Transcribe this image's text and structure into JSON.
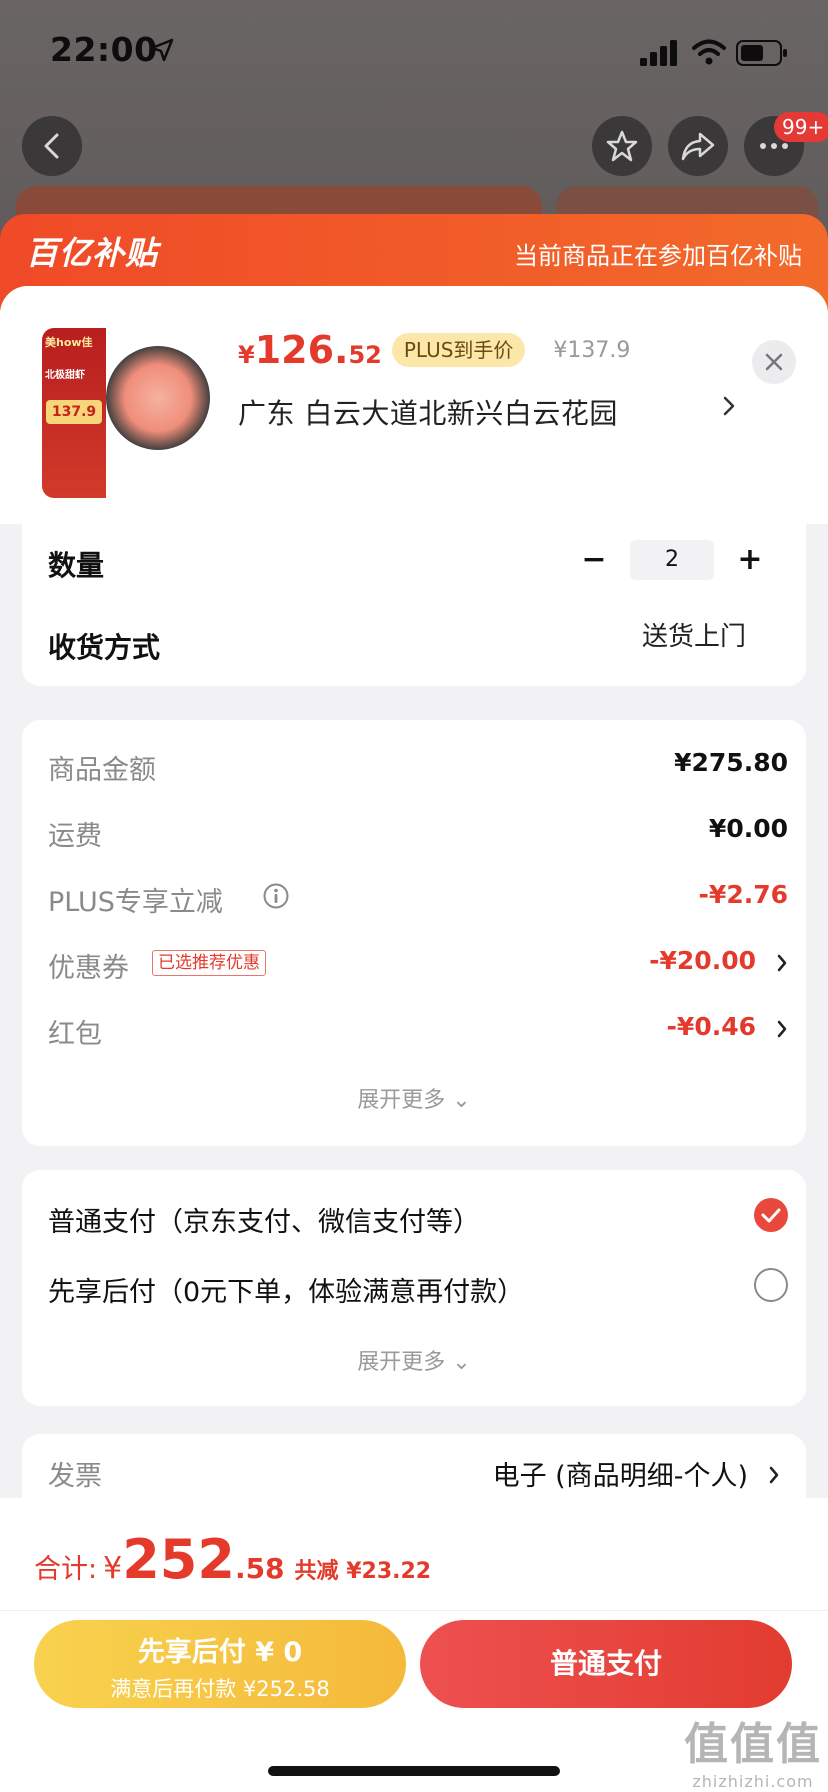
{
  "status_bar": {
    "time": "22:00"
  },
  "top_nav": {
    "badge": "99+"
  },
  "header": {
    "logo": "百亿补贴",
    "note": "当前商品正在参加百亿补贴"
  },
  "product": {
    "thumb_brand": "美how佳",
    "thumb_title": "北极甜虾",
    "thumb_price": "137.9",
    "price_symbol": "¥",
    "price_int": "126.",
    "price_dec": "52",
    "plus_tag": "PLUS到手价",
    "original_price": "¥137.9",
    "address": "广东  白云大道北新兴白云花园"
  },
  "order": {
    "qty_label": "数量",
    "qty_value": "2",
    "delivery_label": "收货方式",
    "delivery_value": "送货上门"
  },
  "costs": {
    "items": [
      {
        "label": "商品金额",
        "value": "¥275.80"
      },
      {
        "label": "运费",
        "value": "¥0.00"
      },
      {
        "label": "PLUS专享立减",
        "value": "-¥2.76"
      },
      {
        "label": "优惠券",
        "tag": "已选推荐优惠",
        "value": "-¥20.00"
      },
      {
        "label": "红包",
        "value": "-¥0.46"
      }
    ],
    "expand": "展开更多 ⌄"
  },
  "payment": {
    "options": [
      {
        "label": "普通支付（京东支付、微信支付等）",
        "selected": true
      },
      {
        "label": "先享后付（0元下单，体验满意再付款）",
        "selected": false
      }
    ],
    "expand": "展开更多 ⌄"
  },
  "invoice": {
    "label": "发票",
    "value": "电子 (商品明细-个人)"
  },
  "bottom": {
    "total_label": "合计:",
    "total_symbol": "¥",
    "total_int": "252",
    "total_dec": ".58",
    "saved": "共减 ¥23.22",
    "btn_later_main": "先享后付 ¥ 0",
    "btn_later_sub": "满意后再付款 ¥252.58",
    "btn_normal": "普通支付"
  },
  "watermark": {
    "main": "值值值",
    "sub": "zhizhizhi.com"
  },
  "colors": {
    "accent": "#e33a2c",
    "header_orange": "#f04a28",
    "gold": "#f8d24e"
  }
}
